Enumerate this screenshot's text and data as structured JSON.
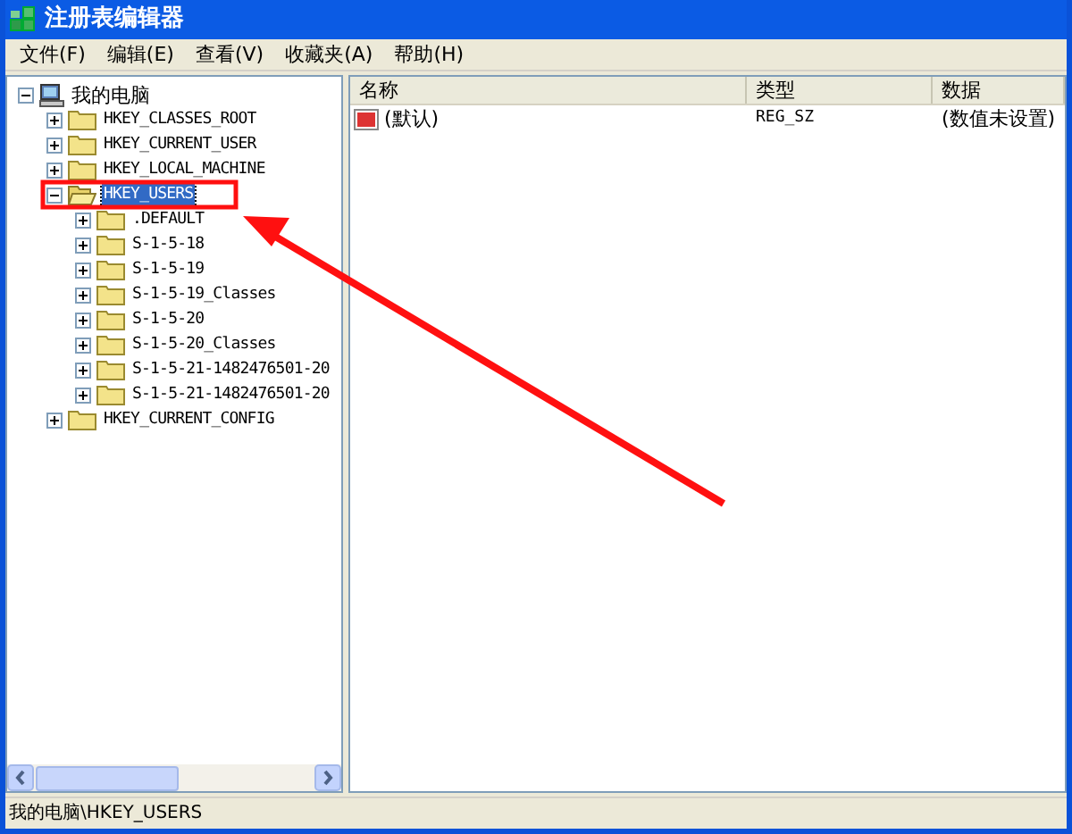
{
  "window": {
    "title": "注册表编辑器"
  },
  "menu": [
    "文件(F)",
    "编辑(E)",
    "查看(V)",
    "收藏夹(A)",
    "帮助(H)"
  ],
  "tree": [
    {
      "label": "我的电脑",
      "kind": "computer",
      "expanded": true,
      "selected": false,
      "children": [
        {
          "label": "HKEY_CLASSES_ROOT",
          "kind": "folder",
          "expanded": false,
          "selected": false
        },
        {
          "label": "HKEY_CURRENT_USER",
          "kind": "folder",
          "expanded": false,
          "selected": false
        },
        {
          "label": "HKEY_LOCAL_MACHINE",
          "kind": "folder",
          "expanded": false,
          "selected": false
        },
        {
          "label": "HKEY_USERS",
          "kind": "folder",
          "expanded": true,
          "selected": true,
          "children": [
            {
              "label": ".DEFAULT",
              "kind": "folder",
              "expanded": false,
              "selected": false
            },
            {
              "label": "S-1-5-18",
              "kind": "folder",
              "expanded": false,
              "selected": false
            },
            {
              "label": "S-1-5-19",
              "kind": "folder",
              "expanded": false,
              "selected": false
            },
            {
              "label": "S-1-5-19_Classes",
              "kind": "folder",
              "expanded": false,
              "selected": false
            },
            {
              "label": "S-1-5-20",
              "kind": "folder",
              "expanded": false,
              "selected": false
            },
            {
              "label": "S-1-5-20_Classes",
              "kind": "folder",
              "expanded": false,
              "selected": false
            },
            {
              "label": "S-1-5-21-1482476501-20",
              "kind": "folder",
              "expanded": false,
              "selected": false
            },
            {
              "label": "S-1-5-21-1482476501-20",
              "kind": "folder",
              "expanded": false,
              "selected": false
            }
          ]
        },
        {
          "label": "HKEY_CURRENT_CONFIG",
          "kind": "folder",
          "expanded": false,
          "selected": false
        }
      ]
    }
  ],
  "list": {
    "columns": [
      "名称",
      "类型",
      "数据"
    ],
    "rows": [
      {
        "name": "(默认)",
        "type": "REG_SZ",
        "data": "(数值未设置)"
      }
    ]
  },
  "status_bar": "我的电脑\\HKEY_USERS"
}
